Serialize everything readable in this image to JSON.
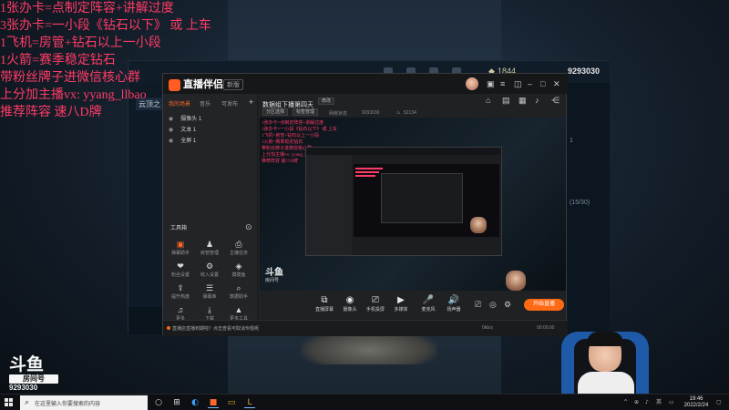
{
  "overlay": {
    "lines": [
      "1张办卡=点制定阵容+讲解过度",
      "3张办卡=一小段《钻石以下》 或 上车",
      "1飞机=房管+钻石以上一小段",
      "1火箭=赛季稳定钻石",
      "带粉丝牌子进微信核心群",
      "上分加主播vx: yyang_llbao",
      "推荐阵容  速八D牌"
    ]
  },
  "watermark": {
    "brand": "斗鱼",
    "label": "房间号",
    "room": "9293030"
  },
  "game": {
    "stat_currency": "1844",
    "room_id": "9293030",
    "tab_label": "云顶之",
    "panel_count": "(15/30)",
    "panel_misc": "1"
  },
  "app": {
    "title": "直播伴侣",
    "version_tag": "新版",
    "left_tabs": [
      "我的场景",
      "音乐",
      "可发布"
    ],
    "sources": [
      "摄像头 1",
      "文本 1",
      "全屏 1"
    ],
    "tools_title": "工具箱",
    "tools": [
      {
        "icon": "▣",
        "label": "弹幕助手"
      },
      {
        "icon": "♟",
        "label": "房管管理"
      },
      {
        "icon": "⎙",
        "label": "主播任务"
      },
      {
        "icon": "❤",
        "label": "粉丝设置"
      },
      {
        "icon": "⚙",
        "label": "收入设置"
      },
      {
        "icon": "◈",
        "label": "摸摸鱼"
      },
      {
        "icon": "⇪",
        "label": "提升热度"
      },
      {
        "icon": "☰",
        "label": "弹幕库"
      },
      {
        "icon": "⌕",
        "label": "数据助手"
      },
      {
        "icon": "♫",
        "label": "更多"
      },
      {
        "icon": "⤓",
        "label": "下载"
      },
      {
        "icon": "▲",
        "label": "更多工具"
      }
    ],
    "stream_title": "数据组下播第四天",
    "stream_badge": "修改",
    "stream_sub1": "网络状态",
    "stream_sub2": "9293030",
    "stream_sub3": "52134",
    "header_btn1": "分区选择",
    "header_btn2": "标签管理",
    "controls": [
      {
        "icon": "⧉",
        "label": "直播屏幕"
      },
      {
        "icon": "◉",
        "label": "摄像头"
      },
      {
        "icon": "⎚",
        "label": "手机投屏"
      },
      {
        "icon": "▶",
        "label": "多媒体"
      },
      {
        "icon": "🎤",
        "label": "麦克风"
      },
      {
        "icon": "🔊",
        "label": "扬声器"
      }
    ],
    "start_label": "开始直播",
    "status_notice": "直播店直播到期啦？点击查看可取消专题呢",
    "status_right": "00:00:00",
    "status_bitrate": "0kb/s"
  },
  "taskbar": {
    "search_placeholder": "在这里输入你要搜索的内容",
    "time": "19:46",
    "date": "2022/2/24"
  }
}
